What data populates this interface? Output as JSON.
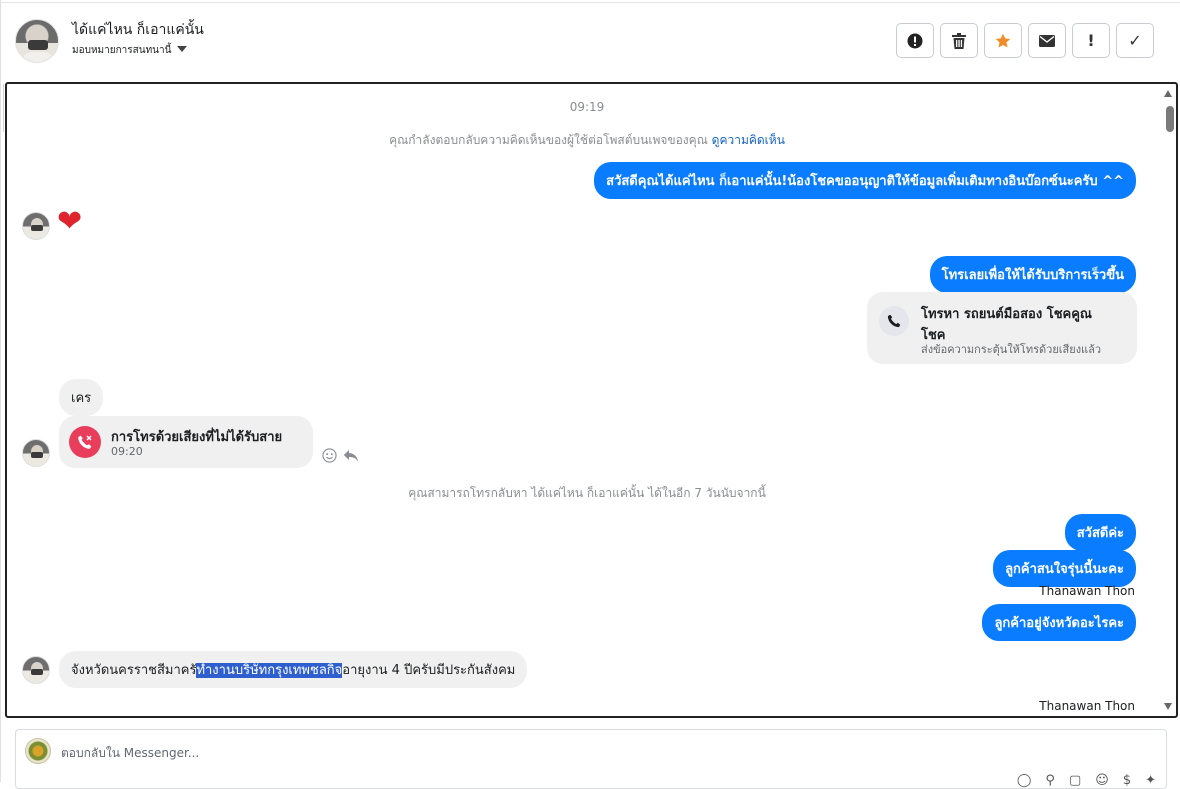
{
  "header": {
    "name": "ได้แค่ไหน ก็เอาแค่นั้น",
    "assign_label": "มอบหมายการสนทนานี้",
    "actions": [
      {
        "id": "spam",
        "icon": "exclamation-circle-icon"
      },
      {
        "id": "delete",
        "icon": "trash-icon"
      },
      {
        "id": "star",
        "icon": "star-icon",
        "color": "#f28c28"
      },
      {
        "id": "unread",
        "icon": "envelope-icon"
      },
      {
        "id": "important",
        "icon": "exclamation-icon",
        "label": "!"
      },
      {
        "id": "done",
        "icon": "checkmark-icon",
        "label": "✓"
      }
    ]
  },
  "chat": {
    "timestamp": "09:19",
    "reply_note": "คุณกำลังตอบกลับความคิดเห็นของผู้ใช้ต่อโพสต์บนเพจของคุณ",
    "reply_note_link": "ดูความคิดเห็น",
    "msg_out_1": "สวัสดีคุณได้แค่ไหน ก็เอาแค่นั้น!น้องโชคขออนุญาติให้ข้อมูลเพิ่มเติมทางอินบ๊อกซ์นะครับ ^^",
    "heart": "❤",
    "msg_out_2": "โทรเลยเพื่อให้ได้รับบริการเร็วขึ้น",
    "call_card": {
      "title_line1": "โทรหา รถยนต์มือสอง โชคคูณ",
      "title_line2": "โชค",
      "subtitle": "ส่งข้อความกระตุ้นให้โทรด้วยเสียงแล้ว"
    },
    "msg_in_1": "เคร",
    "missed_call": {
      "title": "การโทรด้วยเสียงที่ไม่ได้รับสาย",
      "time": "09:20"
    },
    "callback_note": "คุณสามารถโทรกลับหา ได้แค่ไหน ก็เอาแค่นั้น ได้ในอีก 7 วันนับจากนี้",
    "msg_out_3": "สวัสดีค่ะ",
    "msg_out_4": "ลูกค้าสนใจรุ่นนี้นะคะ",
    "sender_1": "Thanawan Thon",
    "msg_out_5": "ลูกค้าอยู่จังหวัดอะไรคะ",
    "msg_in_2": {
      "part1": "จังหวัดนครราชสีมาครั",
      "highlight": "ทำงานบริษัทกรุงเทพชลกิจ",
      "part2": "อายุงาน 4 ปีครับมีประกันสังคม"
    },
    "sender_2": "Thanawan Thon"
  },
  "composer": {
    "placeholder": "ตอบกลับใน Messenger..."
  }
}
